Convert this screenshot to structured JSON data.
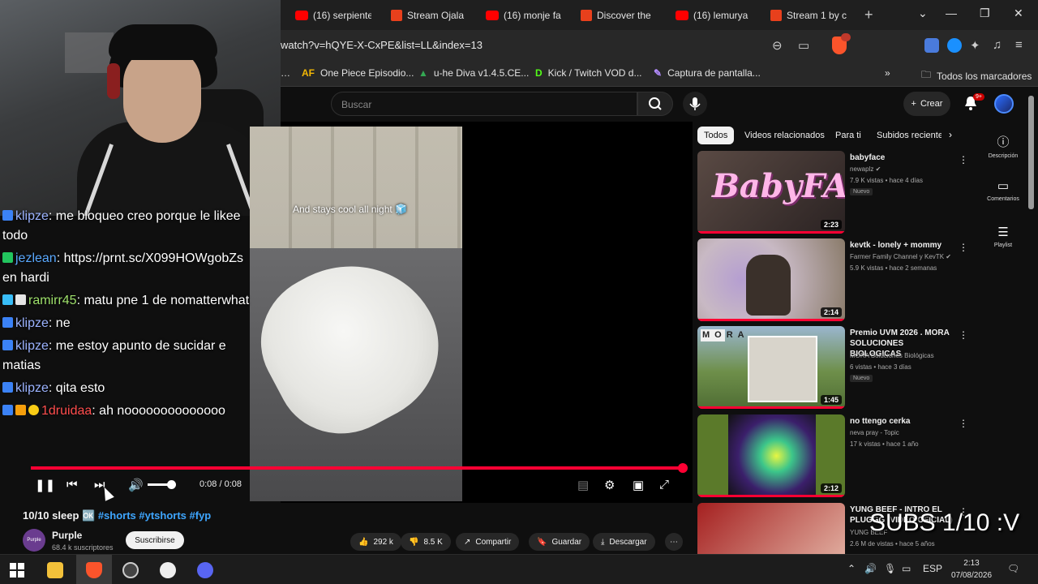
{
  "browser": {
    "tabs": [
      {
        "label": "(16) serpiente",
        "icon": "youtube"
      },
      {
        "label": "Stream Ojala",
        "icon": "kick"
      },
      {
        "label": "(16) monje fa",
        "icon": "youtube"
      },
      {
        "label": "Discover the",
        "icon": "kick"
      },
      {
        "label": "(16) lemurya",
        "icon": "youtube"
      },
      {
        "label": "Stream 1 by c",
        "icon": "kick"
      }
    ],
    "url": "watch?v=hQYE-X-CxPE&list=LL&index=13",
    "brave_badge": "20",
    "bookmarks": [
      {
        "label": "One Piece Episodio...",
        "icon": "AF"
      },
      {
        "label": "u-he Diva v1.4.5.CE...",
        "icon": "drive"
      },
      {
        "label": "Kick / Twitch VOD d...",
        "icon": "D"
      },
      {
        "label": "Captura de pantalla...",
        "icon": "pen"
      }
    ],
    "all_bookmarks_label": "Todos los marcadores"
  },
  "youtube": {
    "search_placeholder": "Buscar",
    "create_label": "Crear",
    "notif_count": "9+"
  },
  "chat": [
    {
      "user": "klipze",
      "text": ": me bloqueo creo porque le likee",
      "color": "#9bb3ff"
    },
    {
      "user": "",
      "text": "todo",
      "color": "#ffffff"
    },
    {
      "user": "jezlean",
      "text": ": https://prnt.sc/X099HOWgobZs",
      "color": "#5aa9ff"
    },
    {
      "user": "",
      "text": "en hardi",
      "color": "#ffffff"
    },
    {
      "user": "ramirr45",
      "text": ": matu pne 1 de nomatterwhat",
      "color": "#9ee06b"
    },
    {
      "user": "klipze",
      "text": ": ne",
      "color": "#9bb3ff"
    },
    {
      "user": "klipze",
      "text": ": me estoy apunto de sucidar e",
      "color": "#9bb3ff"
    },
    {
      "user": "",
      "text": "matias",
      "color": "#ffffff"
    },
    {
      "user": "klipze",
      "text": ": qita esto",
      "color": "#9bb3ff"
    },
    {
      "user": "1druidaa",
      "text": ": ah noooooooooooooo",
      "color": "#ff4d4d"
    }
  ],
  "player": {
    "caption": "And stays cool all night 🧊",
    "time": "0:08 / 0:08",
    "progress": 1.0,
    "volume": 0.8
  },
  "video": {
    "title": "10/10 sleep 🆗",
    "hashtags": "#shorts #ytshorts #fyp",
    "channel": "Purple",
    "subs": "68.4 k suscriptores",
    "avatar_text": "Purple",
    "subscribe_label": "Suscribirse",
    "likes": "292 k",
    "dislikes": "8.5 K",
    "share_label": "Compartir",
    "save_label": "Guardar",
    "download_label": "Descargar"
  },
  "chips": [
    "Todos",
    "Videos relacionados",
    "Para ti",
    "Subidos reciente"
  ],
  "recommendations": [
    {
      "title": "babyface",
      "channel": "newaplz ✔",
      "meta": "7.9 K vistas • hace 4 días",
      "badge": "Nuevo",
      "duration": "2:23",
      "thumb_color": "#3a2f2f"
    },
    {
      "title": "kevtk - lonely + mommy",
      "channel": "Farmer Family Channel y KevTK ✔",
      "meta": "5.9 K vistas • hace 2 semanas",
      "badge": "",
      "duration": "2:14",
      "thumb_color": "#c9b3c7"
    },
    {
      "title": "Premio UVM 2026 . MORA SOLUCIONES BIOLOGICAS",
      "channel": "MORA Soluciones Biológicas",
      "meta": "6 vistas • hace 3 días",
      "badge": "Nuevo",
      "duration": "1:45",
      "thumb_color": "#6e8f4a"
    },
    {
      "title": "no ttengo cerka",
      "channel": "neva pray - Topic",
      "meta": "17 k vistas • hace 1 año",
      "badge": "",
      "duration": "2:12",
      "thumb_color": "#5b7a2a"
    },
    {
      "title": "YUNG BEEF - INTRO EL PLUGGG (VIDEO OFICIAL)",
      "channel": "YUNG BEEF",
      "meta": "2.6 M de vistas • hace 5 años",
      "badge": "",
      "duration": "",
      "thumb_color": "#8b1f1f"
    }
  ],
  "side_buttons": [
    "Descripción",
    "Comentarios",
    "Playlist"
  ],
  "overlay": "SUBS 1/10 :V",
  "taskbar": {
    "lang": "ESP",
    "time": "2:13",
    "date": "07/08/2026"
  }
}
